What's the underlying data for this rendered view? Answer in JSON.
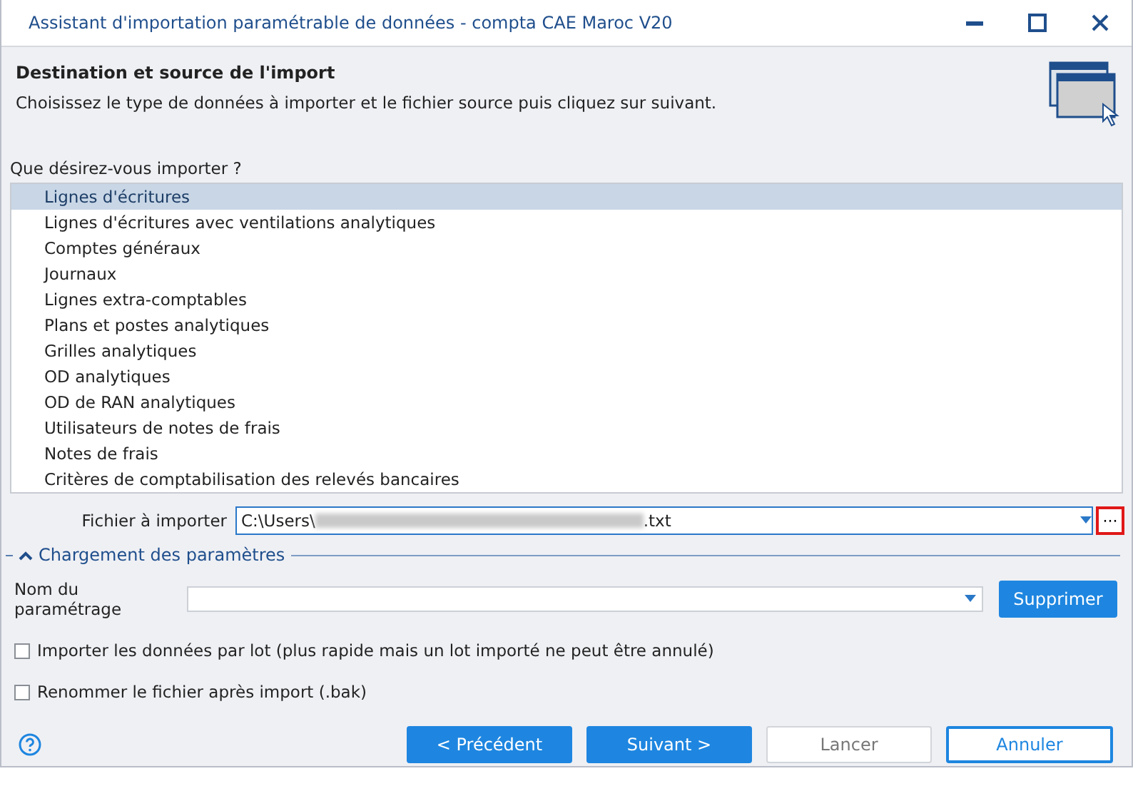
{
  "window": {
    "title": "Assistant d'importation paramétrable de données - compta CAE Maroc V20"
  },
  "header": {
    "title": "Destination et source de l'import",
    "subtitle": "Choisissez le type de données à importer et le fichier source puis cliquez sur suivant."
  },
  "question": "Que désirez-vous importer ?",
  "items": [
    {
      "label": "Lignes d'écritures",
      "selected": true
    },
    {
      "label": "Lignes d'écritures avec ventilations analytiques",
      "selected": false
    },
    {
      "label": "Comptes généraux",
      "selected": false
    },
    {
      "label": "Journaux",
      "selected": false
    },
    {
      "label": "Lignes extra-comptables",
      "selected": false
    },
    {
      "label": "Plans et postes analytiques",
      "selected": false
    },
    {
      "label": "Grilles analytiques",
      "selected": false
    },
    {
      "label": "OD analytiques",
      "selected": false
    },
    {
      "label": "OD de RAN analytiques",
      "selected": false
    },
    {
      "label": "Utilisateurs de notes de frais",
      "selected": false
    },
    {
      "label": "Notes de frais",
      "selected": false
    },
    {
      "label": "Critères de comptabilisation des relevés bancaires",
      "selected": false
    }
  ],
  "file": {
    "label": "Fichier à importer",
    "value_start": "C:\\Users\\",
    "value_end": ".txt",
    "browse": "···",
    "highlighted": true
  },
  "params": {
    "title": "Chargement des paramètres",
    "expanded": true,
    "name_label": "Nom du paramétrage",
    "delete_button": "Supprimer"
  },
  "options": [
    {
      "label": "Importer les données par lot (plus rapide mais un lot importé ne peut être annulé)",
      "checked": false
    },
    {
      "label": "Renommer le fichier après import (.bak)",
      "checked": false
    }
  ],
  "buttons": [
    {
      "label": "< Précédent",
      "kind": "primary",
      "disabled": false
    },
    {
      "label": "Suivant >",
      "kind": "primary",
      "disabled": false
    },
    {
      "label": "Lancer",
      "kind": "secondary",
      "disabled": true
    },
    {
      "label": "Annuler",
      "kind": "outline",
      "disabled": false
    }
  ]
}
